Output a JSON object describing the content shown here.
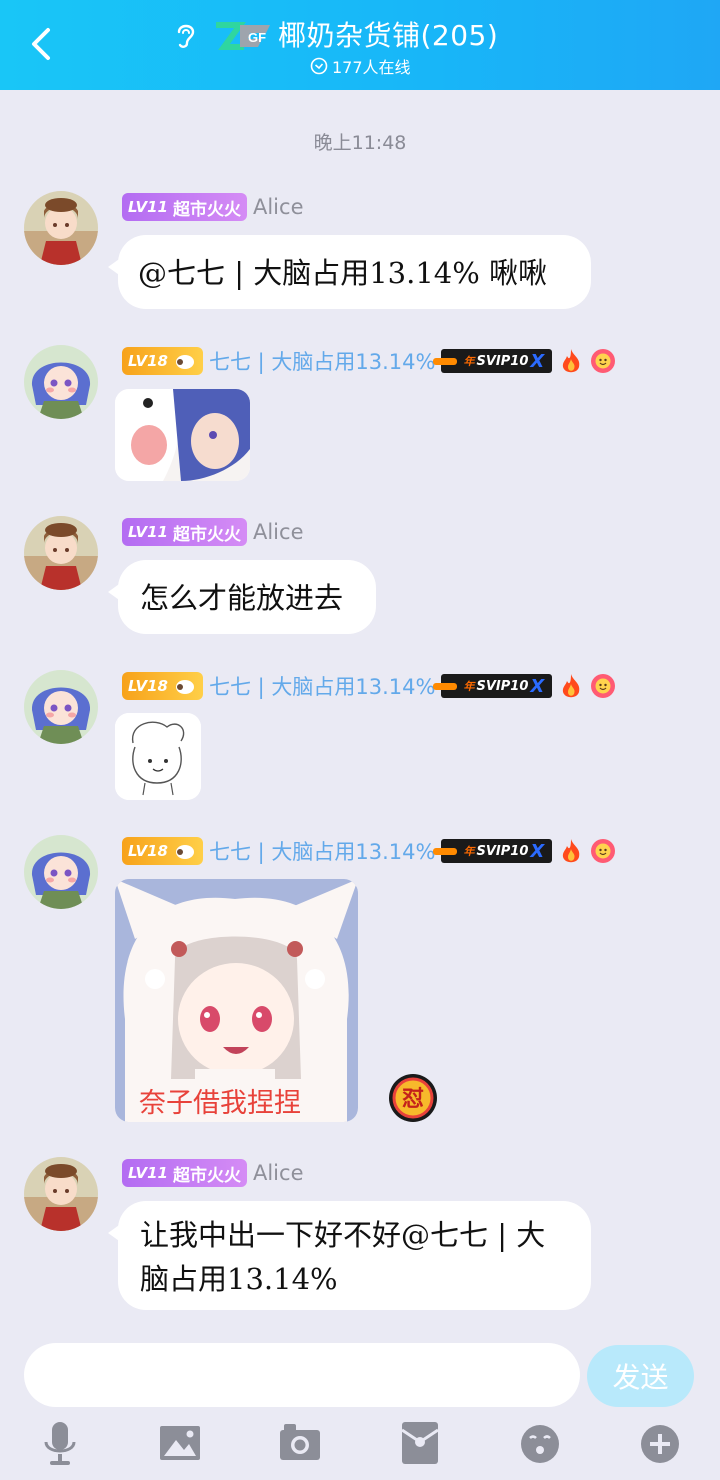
{
  "header": {
    "title": "椰奶杂货铺(205)",
    "online": "177人在线"
  },
  "timestamp": "晚上11:48",
  "messages": [
    {
      "sender": "Alice",
      "level": "LV11",
      "title_tag": "超市火火",
      "text": "@七七 | 大脑占用13.14% 啾啾"
    },
    {
      "sender": "七七 | 大脑占用13.14%",
      "level": "LV18",
      "svip": "SVIP10",
      "svip_prefix": "年",
      "type": "sticker"
    },
    {
      "sender": "Alice",
      "level": "LV11",
      "title_tag": "超市火火",
      "text": "怎么才能放进去"
    },
    {
      "sender": "七七 | 大脑占用13.14%",
      "level": "LV18",
      "svip": "SVIP10",
      "svip_prefix": "年",
      "type": "sticker"
    },
    {
      "sender": "七七 | 大脑占用13.14%",
      "level": "LV18",
      "svip": "SVIP10",
      "svip_prefix": "年",
      "type": "sticker",
      "caption": "奈子借我捏捏",
      "reaction": "怼"
    },
    {
      "sender": "Alice",
      "level": "LV11",
      "title_tag": "超市火火",
      "text_line1": "让我中出一下好不好@七七 | 大",
      "text_line2": "脑占用13.14%"
    }
  ],
  "composer": {
    "placeholder": "",
    "send_label": "发送"
  },
  "toolbar": [
    "microphone-icon",
    "image-icon",
    "camera-icon",
    "red-packet-icon",
    "emoji-icon",
    "plus-icon"
  ],
  "colors": {
    "header": "#19c6f7",
    "background": "#eaeaf4",
    "send_button": "#b8e9fb",
    "level_purple": "#b36cf2",
    "level_orange": "#f7a21a",
    "name_blue": "#63a9ea"
  }
}
